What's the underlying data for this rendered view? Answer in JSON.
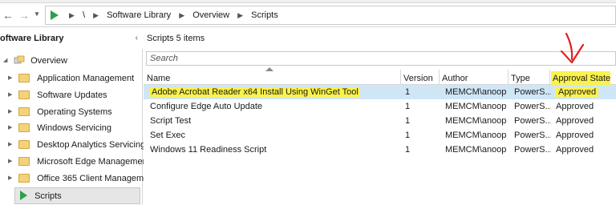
{
  "address_bar": {
    "crumbs": [
      "\\",
      "Software Library",
      "Overview",
      "Scripts"
    ]
  },
  "nav": {
    "title": "oftware Library",
    "overview_label": "Overview",
    "items": [
      {
        "label": "Application Management"
      },
      {
        "label": "Software Updates"
      },
      {
        "label": "Operating Systems"
      },
      {
        "label": "Windows Servicing"
      },
      {
        "label": "Desktop Analytics Servicing"
      },
      {
        "label": "Microsoft Edge Management"
      },
      {
        "label": "Office 365 Client Managemer"
      }
    ],
    "selected_label": "Scripts"
  },
  "main": {
    "title": "Scripts 5 items",
    "search_placeholder": "Search",
    "columns": {
      "name": "Name",
      "version": "Version",
      "author": "Author",
      "type": "Type",
      "approval": "Approval State"
    },
    "rows": [
      {
        "name": "Adobe Acrobat Reader x64 Install Using WinGet Tool",
        "version": "1",
        "author": "MEMCM\\anoop",
        "type": "PowerS...",
        "approval": "Approved"
      },
      {
        "name": "Configure Edge Auto Update",
        "version": "1",
        "author": "MEMCM\\anoop",
        "type": "PowerS...",
        "approval": "Approved"
      },
      {
        "name": "Script Test",
        "version": "1",
        "author": "MEMCM\\anoop",
        "type": "PowerS...",
        "approval": "Approved"
      },
      {
        "name": "Set Exec",
        "version": "1",
        "author": "MEMCM\\anoop",
        "type": "PowerS...",
        "approval": "Approved"
      },
      {
        "name": "Windows 11 Readiness Script",
        "version": "1",
        "author": "MEMCM\\anoop",
        "type": "PowerS...",
        "approval": "Approved"
      }
    ]
  },
  "colors": {
    "highlight": "#fbf24a",
    "selection": "#cfe6f7",
    "annotation_red": "#e02020",
    "play_green": "#2aa14a"
  }
}
